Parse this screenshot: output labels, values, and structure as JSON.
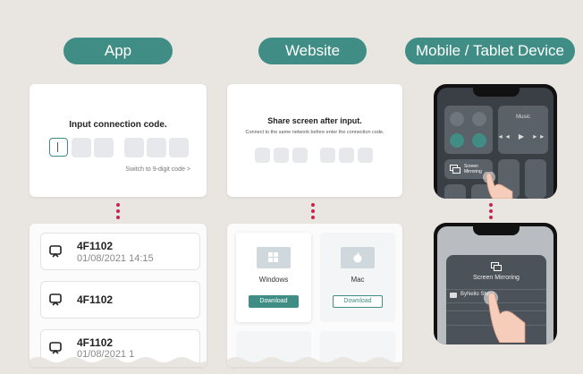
{
  "headers": {
    "app": "App",
    "website": "Website",
    "mobile": "Mobile / Tablet Device"
  },
  "app_code_card": {
    "title": "Input connection code.",
    "switch_link": "Switch to 9-digit code >"
  },
  "app_device_list": [
    {
      "name": "4F1102",
      "date": "01/08/2021 14:15"
    },
    {
      "name": "4F1102",
      "date": ""
    },
    {
      "name": "4F1102",
      "date": "01/08/2021 1"
    }
  ],
  "website_code_card": {
    "title": "Share screen after input.",
    "instruction": "Connect to the same network before enter the connection code."
  },
  "website_download": {
    "windows_label": "Windows",
    "mac_label": "Mac",
    "download_label": "Download"
  },
  "mobile_control_center": {
    "music_label": "Music",
    "screen_mirroring_label": "Screen Mirroring"
  },
  "mobile_mirroring_panel": {
    "title": "Screen Mirroring",
    "device_label": "ByNello Share"
  },
  "colors": {
    "accent": "#3f8d84",
    "dots": "#c8244a",
    "background": "#e9e6e2"
  }
}
